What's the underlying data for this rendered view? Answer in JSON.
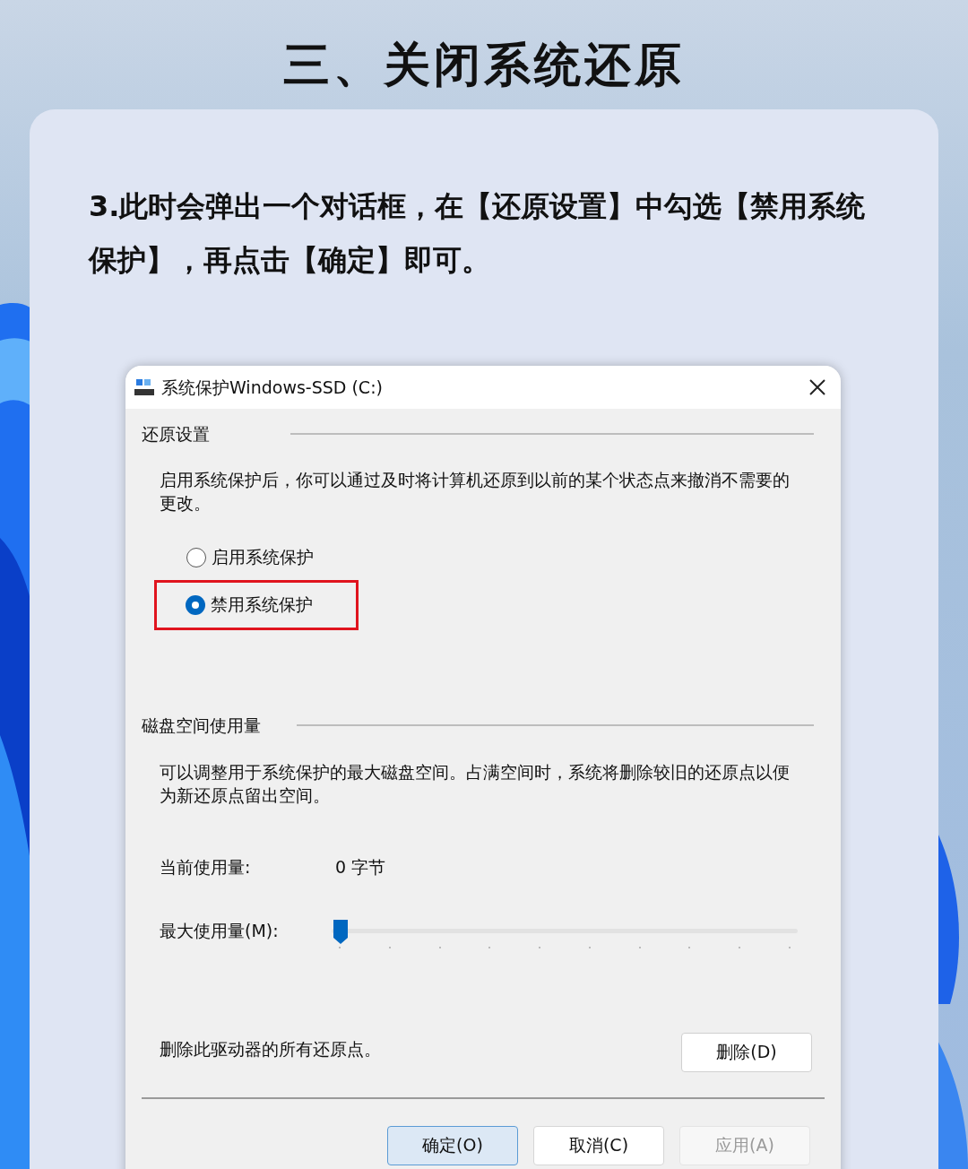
{
  "heading": "三、关闭系统还原",
  "instruction": "3.此时会弹出一个对话框，在【还原设置】中勾选【禁用系统保护】，再点击【确定】即可。",
  "dialog": {
    "title": "系统保护Windows-SSD (C:)",
    "restore_settings": {
      "label": "还原设置",
      "description": "启用系统保护后，你可以通过及时将计算机还原到以前的某个状态点来撤消不需要的更改。",
      "options": [
        {
          "label": "启用系统保护",
          "selected": false,
          "highlighted": false
        },
        {
          "label": "禁用系统保护",
          "selected": true,
          "highlighted": true
        }
      ]
    },
    "disk_usage": {
      "label": "磁盘空间使用量",
      "description": "可以调整用于系统保护的最大磁盘空间。占满空间时，系统将删除较旧的还原点以便为新还原点留出空间。",
      "current_label": "当前使用量:",
      "current_value": "0 字节",
      "max_label": "最大使用量(M):",
      "slider": {
        "level": 0
      }
    },
    "delete_text": "删除此驱动器的所有还原点。",
    "delete_button": "删除(D)",
    "buttons": [
      {
        "label": "确定(O)",
        "kind": "default",
        "disabled": false
      },
      {
        "label": "取消(C)",
        "kind": "normal",
        "disabled": false
      },
      {
        "label": "应用(A)",
        "kind": "normal",
        "disabled": true
      }
    ]
  }
}
